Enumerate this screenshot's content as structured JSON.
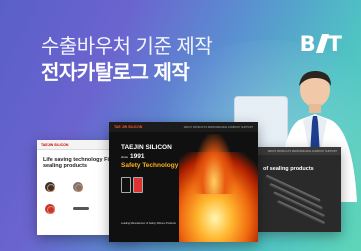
{
  "banner": {
    "headline_line1": "수출바우처 기준 제작",
    "headline_line2": "전자카탈로그 제작",
    "logo_left": "B",
    "logo_right": "T"
  },
  "catalogs": {
    "left": {
      "brand": "TAEJIN SILICON",
      "title": "Life saving technology Fireproof sealing products"
    },
    "center": {
      "brand": "TAE JIN SILICON",
      "nav": "ABOUT   PRODUCTS   PERFORMANCE   COMPANY   SUPPORT",
      "company": "TAEJIN SILICON",
      "since_label": "since",
      "since_year": "1991",
      "tagline": "Safety Technology",
      "footer": "Leading Manufacturer of Safety Silicone Products"
    },
    "right": {
      "title": "of sealing products"
    }
  },
  "colors": {
    "gradient_start": "#5a5fc8",
    "gradient_end": "#5fd6b9",
    "tagline": "#ffb020"
  }
}
